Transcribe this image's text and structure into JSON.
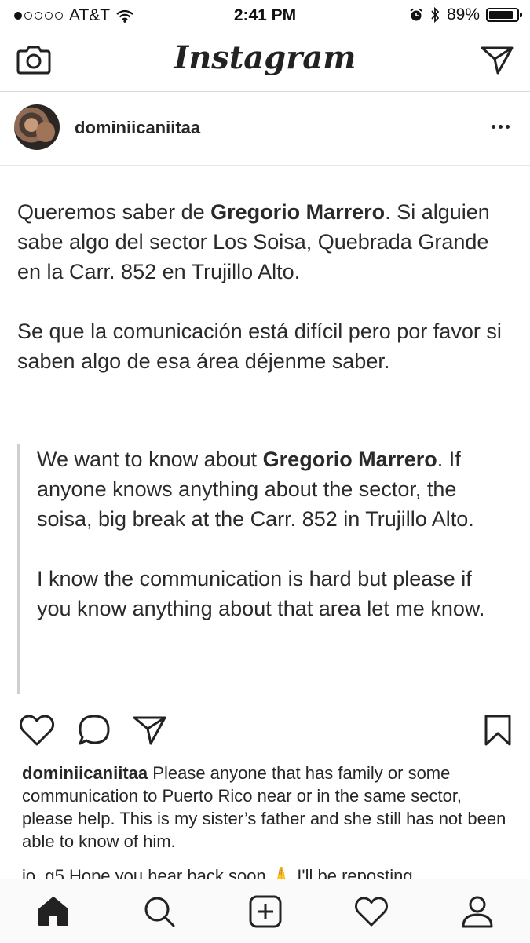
{
  "status_bar": {
    "carrier": "AT&T",
    "time": "2:41 PM",
    "battery_percent": "89%",
    "battery_level": 0.89,
    "signal_dots_filled": 1,
    "icons": [
      "wifi-icon",
      "alarm-icon",
      "bluetooth-icon",
      "battery-icon"
    ]
  },
  "header": {
    "title": "Instagram",
    "left_icon": "camera-icon",
    "right_icon": "direct-message-icon"
  },
  "post": {
    "username": "dominiicaniitaa",
    "spanish": {
      "p1_before": "Queremos saber de ",
      "p1_bold": "Gregorio Marrero",
      "p1_after": ". Si alguien sabe algo del sector Los Soisa, Quebrada Grande en la Carr. 852 en Trujillo Alto.",
      "p2": "Se que la comunicación está difícil pero por favor si saben algo de esa área déjenme saber."
    },
    "translation": {
      "p1_before": "We want to know about ",
      "p1_bold": "Gregorio Marrero",
      "p1_after": ". If anyone knows anything about the sector, the soisa, big break at the Carr. 852 in Trujillo Alto.",
      "p2": "I know the communication is hard but please if you know anything about that area let me know."
    },
    "caption_username": "dominiicaniitaa",
    "caption_text": "Please anyone that has family or some communication to Puerto Rico near or in the same sector, please help. This is my sister’s father and she still has not been able to know of him.",
    "comment_peek": "jo_g5 Hope you hear back soon 🙏 I'll be reposting"
  },
  "tab_bar": {
    "items": [
      "home-icon",
      "search-icon",
      "new-post-icon",
      "activity-icon",
      "profile-icon"
    ]
  }
}
